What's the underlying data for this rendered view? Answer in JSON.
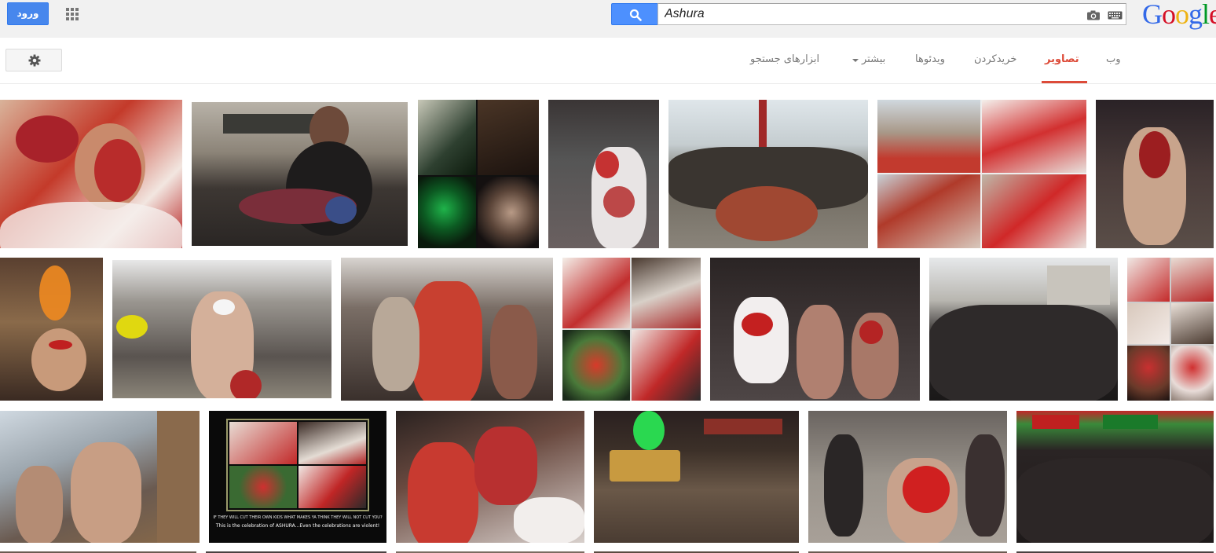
{
  "header": {
    "signin_label": "ورود",
    "search_query": "Ashura",
    "logo_letters": [
      "G",
      "o",
      "o",
      "g",
      "l",
      "e"
    ],
    "icons": [
      "apps-grid-icon",
      "search-icon",
      "camera-icon",
      "keyboard-icon"
    ]
  },
  "nav": {
    "tabs": [
      {
        "label": "وب",
        "active": false
      },
      {
        "label": "تصاویر",
        "active": true
      },
      {
        "label": "خریدکردن",
        "active": false
      },
      {
        "label": "ویدئوها",
        "active": false
      },
      {
        "label": "بیشتر",
        "active": false
      },
      {
        "label": "ابزارهای جستجو",
        "active": false
      }
    ],
    "settings_icon": "gear-icon"
  },
  "colors": {
    "accent_red": "#dd4b39",
    "button_blue": "#4d90fe",
    "header_bg": "#f1f1f1"
  },
  "results": {
    "caption_line1": "IF THEY WILL CUT THEIR OWN KIDS WHAT MAKES YA THINK THEY WILL NOT CUT YOU?",
    "caption_line2": "This is the celebration of ASHURA...Even the celebrations are violent!"
  }
}
